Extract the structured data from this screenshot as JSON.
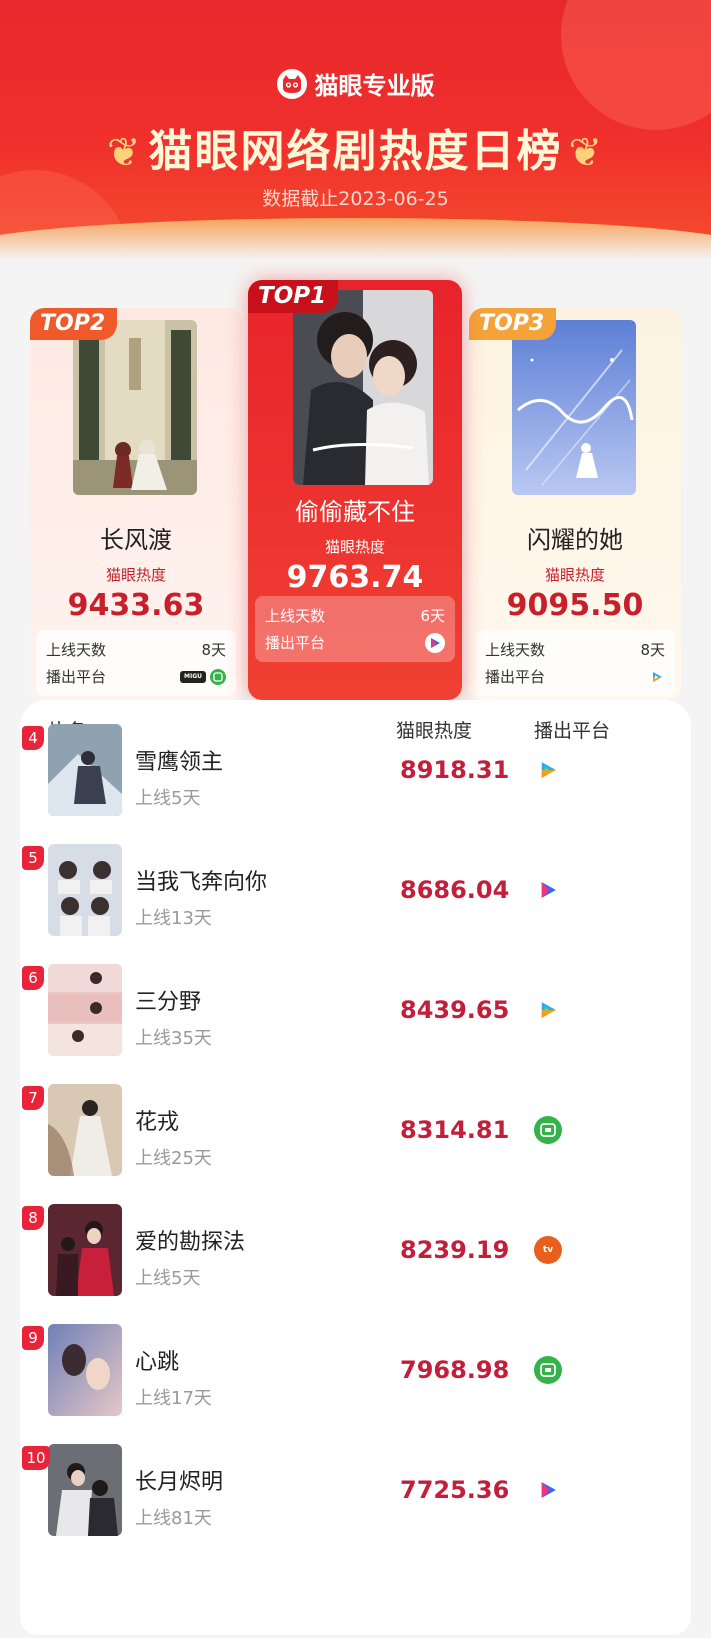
{
  "header": {
    "brand": "猫眼专业版",
    "title": "猫眼网络剧热度日榜",
    "date_note": "数据截止2023-06-25"
  },
  "labels": {
    "heat": "猫眼热度",
    "online_days": "上线天数",
    "platform": "播出平台"
  },
  "top3": [
    {
      "rank_tag": "TOP1",
      "name": "偷偷藏不住",
      "heat": "9763.74",
      "days": "6天",
      "platforms": [
        "youku"
      ]
    },
    {
      "rank_tag": "TOP2",
      "name": "长风渡",
      "heat": "9433.63",
      "days": "8天",
      "platforms": [
        "migu",
        "iqiyi"
      ]
    },
    {
      "rank_tag": "TOP3",
      "name": "闪耀的她",
      "heat": "9095.50",
      "days": "8天",
      "platforms": [
        "tencent"
      ]
    }
  ],
  "list": {
    "col_name": "片名",
    "col_heat": "猫眼热度",
    "col_platform": "播出平台",
    "rows": [
      {
        "rank": "4",
        "name": "雪鹰领主",
        "days": "上线5天",
        "heat": "8918.31",
        "platform": "tencent"
      },
      {
        "rank": "5",
        "name": "当我飞奔向你",
        "days": "上线13天",
        "heat": "8686.04",
        "platform": "youku"
      },
      {
        "rank": "6",
        "name": "三分野",
        "days": "上线35天",
        "heat": "8439.65",
        "platform": "tencent"
      },
      {
        "rank": "7",
        "name": "花戎",
        "days": "上线25天",
        "heat": "8314.81",
        "platform": "iqiyi"
      },
      {
        "rank": "8",
        "name": "爱的勘探法",
        "days": "上线5天",
        "heat": "8239.19",
        "platform": "mango"
      },
      {
        "rank": "9",
        "name": "心跳",
        "days": "上线17天",
        "heat": "7968.98",
        "platform": "iqiyi"
      },
      {
        "rank": "10",
        "name": "长月烬明",
        "days": "上线81天",
        "heat": "7725.36",
        "platform": "youku"
      }
    ]
  },
  "platform_icon_text": {
    "iqiyi": "iQIYI",
    "mango": "tv",
    "migu": "MIGU"
  },
  "colors": {
    "brand_red": "#e8282c",
    "heat_red": "#c41f3a",
    "iqiyi_green": "#34b349",
    "mango_orange": "#e8601c"
  }
}
